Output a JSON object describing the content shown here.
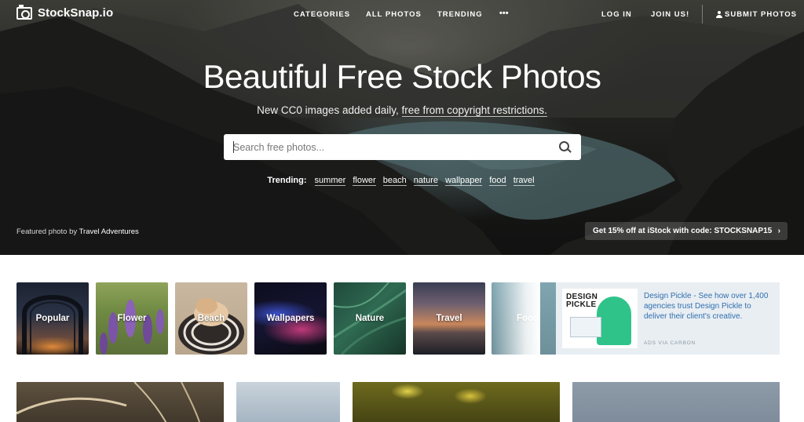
{
  "brand": {
    "name": "StockSnap.io"
  },
  "nav": {
    "categories": "CATEGORIES",
    "all_photos": "ALL PHOTOS",
    "trending": "TRENDING",
    "more": "•••",
    "login": "LOG IN",
    "join": "JOIN US!",
    "submit": "SUBMIT PHOTOS"
  },
  "hero": {
    "title": "Beautiful Free Stock Photos",
    "subtitle_prefix": "New CC0 images added daily,",
    "subtitle_link": "free from copyright restrictions.",
    "search_placeholder": "Search free photos...",
    "trending_label": "Trending:",
    "trending_tags": [
      "summer",
      "flower",
      "beach",
      "nature",
      "wallpaper",
      "food",
      "travel"
    ],
    "credit_prefix": "Featured photo by",
    "credit_name": "Travel Adventures",
    "promo": "Get 15% off at iStock with code: STOCKSNAP15",
    "promo_chevron": "›"
  },
  "categories": [
    {
      "label": "Popular"
    },
    {
      "label": "Flower"
    },
    {
      "label": "Beach"
    },
    {
      "label": "Wallpapers"
    },
    {
      "label": "Nature"
    },
    {
      "label": "Travel"
    },
    {
      "label": "Food"
    }
  ],
  "ad": {
    "logo_line1": "DESIGN",
    "logo_line2": "PICKLE",
    "text": "Design Pickle - See how over 1,400 agencies trust Design Pickle to deliver their client's creative.",
    "via": "ADS VIA CARBON"
  },
  "colors": {
    "ad_link": "#2f6fb0",
    "ad_background": "#e9eef2",
    "brand_green": "#2fc38a"
  }
}
